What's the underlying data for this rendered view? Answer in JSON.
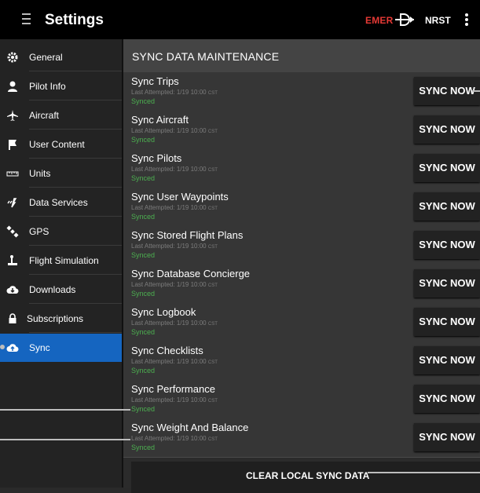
{
  "header": {
    "title": "Settings",
    "emer_label": "EMER",
    "nrst_label": "NRST",
    "menu_icon": "hamburger-menu-icon",
    "route_icon": "direct-to-icon",
    "overflow_icon": "kebab-menu-icon",
    "emer_color": "#e53935"
  },
  "sidebar": {
    "accent_color": "#1565c0",
    "items": [
      {
        "label": "General",
        "icon": "gear-icon"
      },
      {
        "label": "Pilot Info",
        "icon": "pilot-icon"
      },
      {
        "label": "Aircraft",
        "icon": "airplane-icon"
      },
      {
        "label": "User Content",
        "icon": "flag-icon"
      },
      {
        "label": "Units",
        "icon": "ruler-icon"
      },
      {
        "label": "Data Services",
        "icon": "signal-icon"
      },
      {
        "label": "GPS",
        "icon": "satellite-icon"
      },
      {
        "label": "Flight Simulation",
        "icon": "joystick-icon"
      },
      {
        "label": "Downloads",
        "icon": "cloud-download-icon"
      },
      {
        "label": "Subscriptions",
        "icon": "lock-icon"
      },
      {
        "label": "Sync",
        "icon": "cloud-upload-icon",
        "active": true
      }
    ]
  },
  "main": {
    "section_title": "SYNC DATA MAINTENANCE",
    "sync_button_label": "SYNC NOW",
    "status_color": "#4caf50",
    "rows": [
      {
        "name": "Sync Trips",
        "attempt_prefix": "Last Attempted: 1/19 10:00",
        "tz": "CST",
        "status": "Synced"
      },
      {
        "name": "Sync Aircraft",
        "attempt_prefix": "Last Attempted: 1/19 10:00",
        "tz": "CST",
        "status": "Synced"
      },
      {
        "name": "Sync Pilots",
        "attempt_prefix": "Last Attempted: 1/19 10:00",
        "tz": "CST",
        "status": "Synced"
      },
      {
        "name": "Sync User Waypoints",
        "attempt_prefix": "Last Attempted: 1/19 10:00",
        "tz": "CST",
        "status": "Synced"
      },
      {
        "name": "Sync Stored Flight Plans",
        "attempt_prefix": "Last Attempted: 1/19 10:00",
        "tz": "CST",
        "status": "Synced"
      },
      {
        "name": "Sync Database Concierge",
        "attempt_prefix": "Last Attempted: 1/19 10:00",
        "tz": "CST",
        "status": "Synced"
      },
      {
        "name": "Sync Logbook",
        "attempt_prefix": "Last Attempted: 1/19 10:00",
        "tz": "CST",
        "status": "Synced"
      },
      {
        "name": "Sync Checklists",
        "attempt_prefix": "Last Attempted: 1/19 10:00",
        "tz": "CST",
        "status": "Synced"
      },
      {
        "name": "Sync Performance",
        "attempt_prefix": "Last Attempted: 1/19 10:00",
        "tz": "CST",
        "status": "Synced"
      },
      {
        "name": "Sync Weight And Balance",
        "attempt_prefix": "Last Attempted: 1/19 10:00",
        "tz": "CST",
        "status": "Synced"
      }
    ],
    "clear_label": "CLEAR LOCAL SYNC DATA"
  }
}
